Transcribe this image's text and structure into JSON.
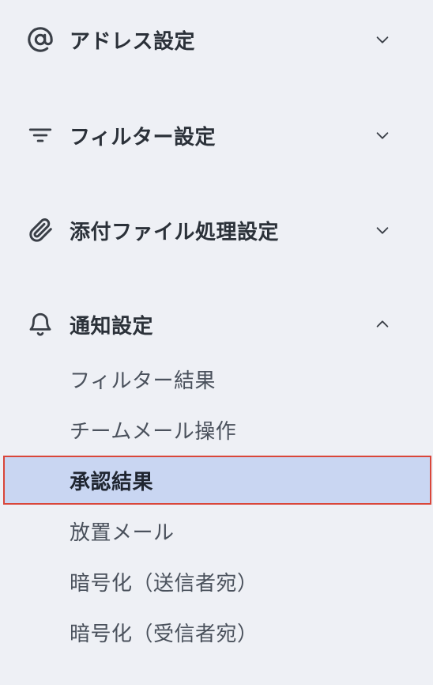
{
  "sections": [
    {
      "label": "アドレス設定",
      "icon": "at-sign-icon",
      "expanded": false
    },
    {
      "label": "フィルター設定",
      "icon": "filter-icon",
      "expanded": false
    },
    {
      "label": "添付ファイル処理設定",
      "icon": "paperclip-icon",
      "expanded": false
    },
    {
      "label": "通知設定",
      "icon": "bell-icon",
      "expanded": true
    }
  ],
  "notification_items": [
    {
      "label": "フィルター結果"
    },
    {
      "label": "チームメール操作"
    },
    {
      "label": "承認結果",
      "selected": true
    },
    {
      "label": "放置メール"
    },
    {
      "label": "暗号化（送信者宛）"
    },
    {
      "label": "暗号化（受信者宛）"
    }
  ],
  "colors": {
    "background": "#eef0f5",
    "selected_background": "#c9d6f2",
    "selected_outline": "#d9463a",
    "text": "#2b3139"
  }
}
